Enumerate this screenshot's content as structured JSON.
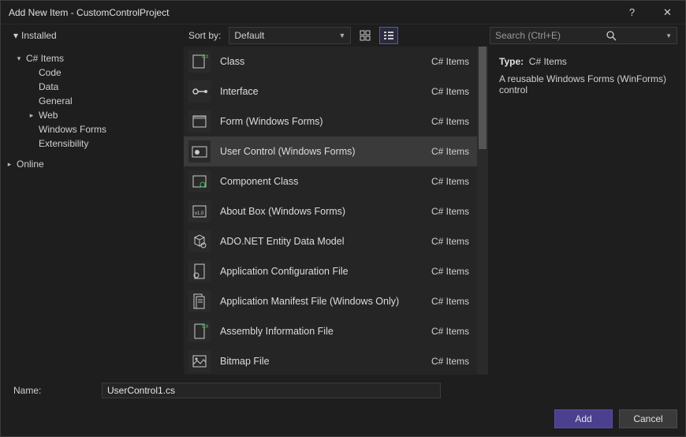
{
  "window": {
    "title": "Add New Item - CustomControlProject"
  },
  "titlebar": {
    "help": "?",
    "close": "✕"
  },
  "tree": {
    "installed": "Installed",
    "csharp_items": "C# Items",
    "children": [
      "Code",
      "Data",
      "General",
      "Web",
      "Windows Forms",
      "Extensibility"
    ],
    "online": "Online"
  },
  "toolbar": {
    "sort_by_label": "Sort by:",
    "sort_value": "Default",
    "search_placeholder": "Search (Ctrl+E)"
  },
  "items": [
    {
      "name": "Class",
      "cat": "C# Items",
      "icon": "class"
    },
    {
      "name": "Interface",
      "cat": "C# Items",
      "icon": "interface"
    },
    {
      "name": "Form (Windows Forms)",
      "cat": "C# Items",
      "icon": "form"
    },
    {
      "name": "User Control (Windows Forms)",
      "cat": "C# Items",
      "icon": "usercontrol",
      "selected": true
    },
    {
      "name": "Component Class",
      "cat": "C# Items",
      "icon": "component"
    },
    {
      "name": "About Box (Windows Forms)",
      "cat": "C# Items",
      "icon": "about"
    },
    {
      "name": "ADO.NET Entity Data Model",
      "cat": "C# Items",
      "icon": "ado"
    },
    {
      "name": "Application Configuration File",
      "cat": "C# Items",
      "icon": "config"
    },
    {
      "name": "Application Manifest File (Windows Only)",
      "cat": "C# Items",
      "icon": "manifest"
    },
    {
      "name": "Assembly Information File",
      "cat": "C# Items",
      "icon": "assembly"
    },
    {
      "name": "Bitmap File",
      "cat": "C# Items",
      "icon": "bitmap"
    }
  ],
  "info": {
    "type_label": "Type:",
    "type_value": "C# Items",
    "description": "A reusable Windows Forms (WinForms) control"
  },
  "name_row": {
    "label": "Name:",
    "value": "UserControl1.cs"
  },
  "footer": {
    "add": "Add",
    "cancel": "Cancel"
  }
}
